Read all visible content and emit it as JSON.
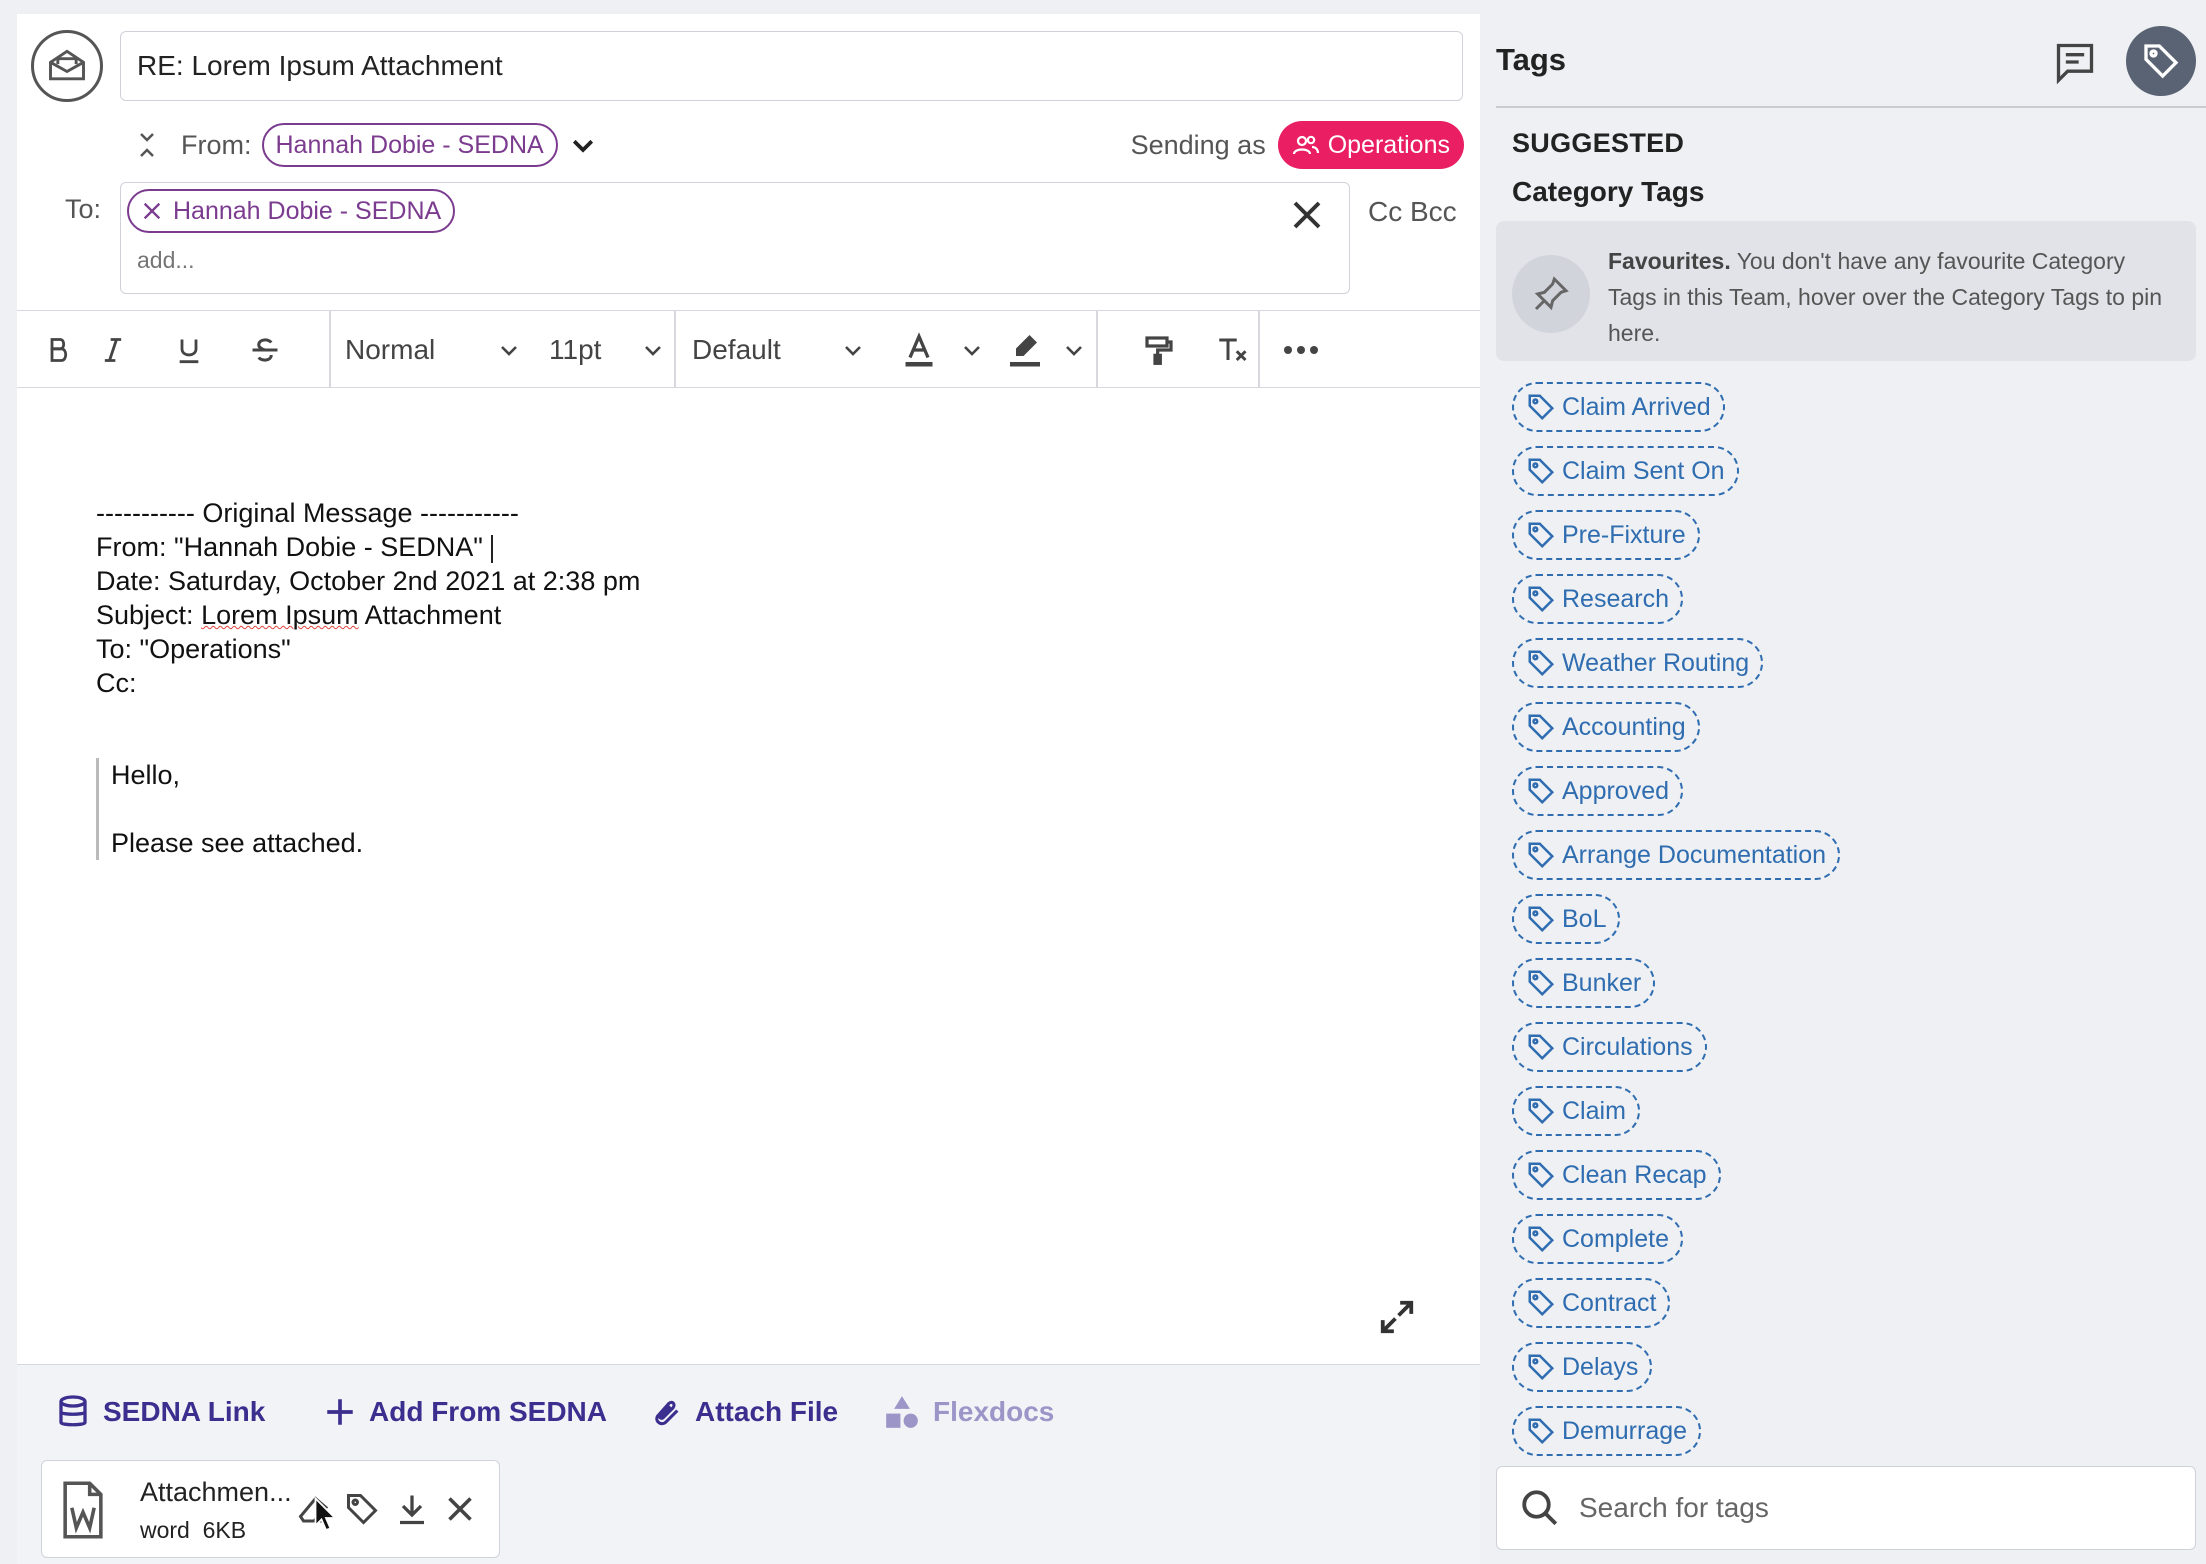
{
  "composer": {
    "subject": "RE: Lorem Ipsum Attachment",
    "from_label": "From:",
    "from_chip": "Hannah Dobie - SEDNA",
    "sending_as_label": "Sending as",
    "sending_as_team": "Operations",
    "to_label": "To:",
    "to_chip": "Hannah Dobie - SEDNA",
    "to_placeholder": "add...",
    "cc_bcc": "Cc Bcc"
  },
  "toolbar": {
    "style_value": "Normal",
    "size_value": "11pt",
    "font_value": "Default"
  },
  "message": {
    "divider": "----------- Original Message -----------",
    "from_line": "From: \"Hannah Dobie - SEDNA\"",
    "date_line": "Date: Saturday, October 2nd 2021 at 2:38 pm",
    "subject_prefix": "Subject: ",
    "subject_spell": "Lorem Ipsum",
    "subject_rest": " Attachment",
    "to_line": "To: \"Operations\"",
    "cc_line": "Cc:",
    "quote_greeting": "Hello,",
    "quote_body": "Please see attached."
  },
  "actions": {
    "sedna_link": "SEDNA Link",
    "add_from_sedna": "Add From SEDNA",
    "attach_file": "Attach File",
    "flexdocs": "Flexdocs"
  },
  "attachment": {
    "name": "Attachmen...",
    "type": "word",
    "size": "6KB"
  },
  "tags_panel": {
    "title": "Tags",
    "suggested": "SUGGESTED",
    "category_title": "Category Tags",
    "fav_bold": "Favourites.",
    "fav_text": " You don't have any favourite Category Tags in this Team, hover over the Category Tags to pin here.",
    "tags": [
      "Claim Arrived",
      "Claim Sent On",
      "Pre-Fixture",
      "Research",
      "Weather Routing",
      "Accounting",
      "Approved",
      "Arrange Documentation",
      "BoL",
      "Bunker",
      "Circulations",
      "Claim",
      "Clean Recap",
      "Complete",
      "Contract",
      "Delays",
      "Demurrage"
    ],
    "search_placeholder": "Search for tags"
  },
  "colors": {
    "accent_purple": "#7b3b8f",
    "operations_pink": "#e91e63",
    "tag_blue": "#2f6db0",
    "action_indigo": "#3a2f8f"
  }
}
